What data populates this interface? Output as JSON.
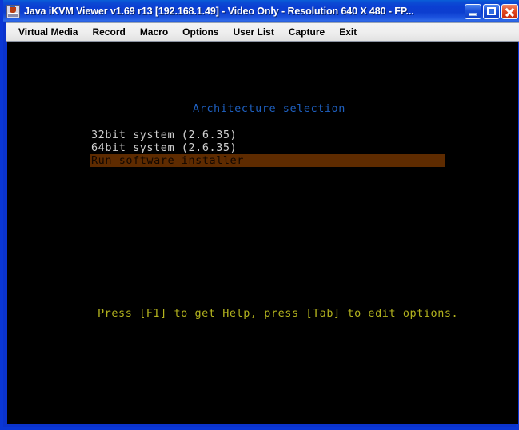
{
  "window": {
    "title": "Java iKVM Viewer v1.69 r13 [192.168.1.49]  - Video Only - Resolution 640 X 480 - FP...",
    "icon": "java-viewer-icon",
    "controls": {
      "minimize": "minimize-button",
      "maximize": "maximize-button",
      "close": "close-button"
    },
    "colors": {
      "titlebar_blue": "#0b3fd2",
      "frame_blue": "#0a37d6",
      "menubar_gray": "#eeeeee"
    }
  },
  "menubar": {
    "items": [
      {
        "label": "Virtual Media",
        "name": "menu-virtual-media"
      },
      {
        "label": "Record",
        "name": "menu-record"
      },
      {
        "label": "Macro",
        "name": "menu-macro"
      },
      {
        "label": "Options",
        "name": "menu-options"
      },
      {
        "label": "User List",
        "name": "menu-user-list"
      },
      {
        "label": "Capture",
        "name": "menu-capture"
      },
      {
        "label": "Exit",
        "name": "menu-exit"
      }
    ]
  },
  "console": {
    "title": "Architecture selection",
    "title_color": "#1e5fbe",
    "background": "#000000",
    "entries": [
      {
        "label": "32bit system (2.6.35)",
        "selected": false
      },
      {
        "label": "64bit system (2.6.35)",
        "selected": false
      },
      {
        "label": "Run software installer",
        "selected": true
      }
    ],
    "selected_bg": "#5e2b00",
    "help_text": "Press [F1] to get Help, press [Tab] to edit options.",
    "help_color": "#b2b21e"
  }
}
